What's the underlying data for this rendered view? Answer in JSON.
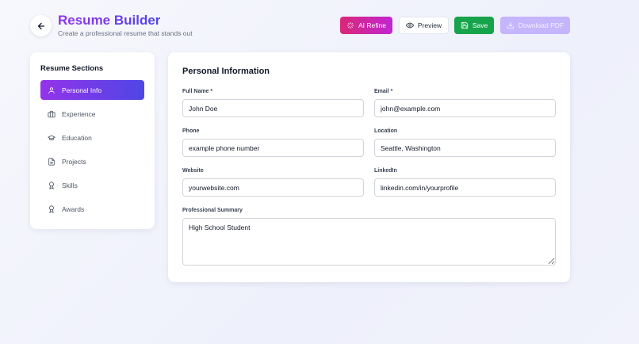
{
  "header": {
    "title": "Resume Builder",
    "subtitle": "Create a professional resume that stands out"
  },
  "toolbar": {
    "ai_refine_label": "AI Refine",
    "preview_label": "Preview",
    "save_label": "Save",
    "download_label": "Download PDF"
  },
  "sidebar": {
    "title": "Resume Sections",
    "items": [
      {
        "label": "Personal Info",
        "icon": "user-icon",
        "active": true
      },
      {
        "label": "Experience",
        "icon": "briefcase-icon",
        "active": false
      },
      {
        "label": "Education",
        "icon": "graduation-cap-icon",
        "active": false
      },
      {
        "label": "Projects",
        "icon": "document-icon",
        "active": false
      },
      {
        "label": "Skills",
        "icon": "award-icon",
        "active": false
      },
      {
        "label": "Awards",
        "icon": "award-icon",
        "active": false
      }
    ]
  },
  "form": {
    "title": "Personal Information",
    "full_name": {
      "label": "Full Name *",
      "value": "John Doe"
    },
    "email": {
      "label": "Email *",
      "value": "john@example.com"
    },
    "phone": {
      "label": "Phone",
      "value": "example phone number"
    },
    "location": {
      "label": "Location",
      "value": "Seattle, Washington"
    },
    "website": {
      "label": "Website",
      "value": "yourwebsite.com"
    },
    "linkedin": {
      "label": "LinkedIn",
      "value": "linkedin.com/in/yourprofile"
    },
    "summary": {
      "label": "Professional Summary",
      "value": "High School Student"
    }
  },
  "colors": {
    "accent_gradient_start": "#9333ea",
    "accent_gradient_end": "#4f46e5",
    "refine": "#db2777",
    "save": "#16a34a",
    "download_disabled": "#c4b5fd"
  }
}
